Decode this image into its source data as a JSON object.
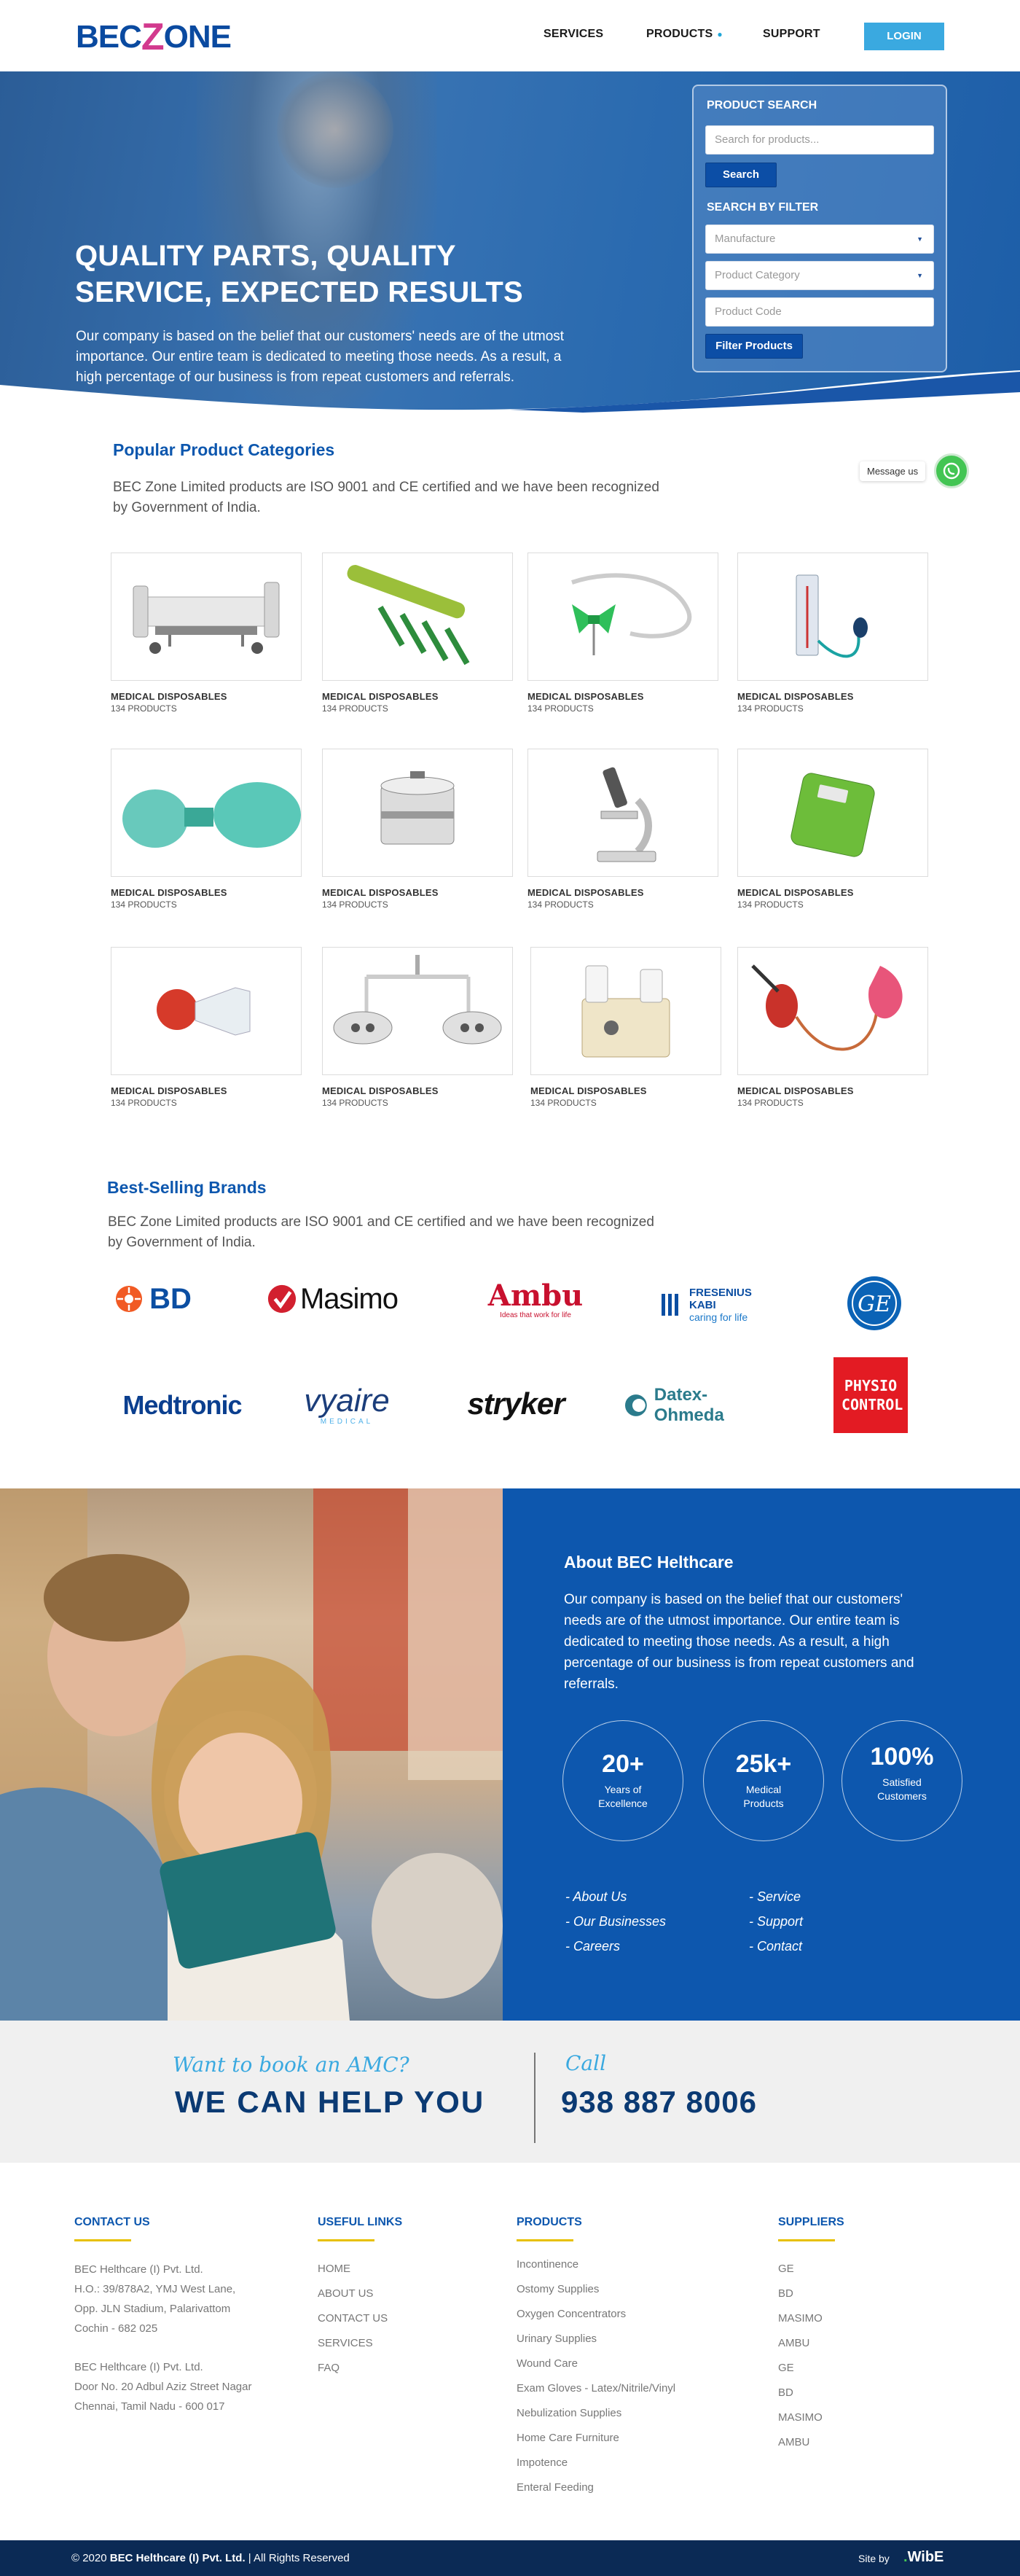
{
  "header": {
    "logo_bec": "BEC",
    "logo_z": "Z",
    "logo_one": "ONE",
    "nav": {
      "services": "SERVICES",
      "products": "PRODUCTS",
      "support": "SUPPORT"
    },
    "login": "LOGIN"
  },
  "hero": {
    "title": "QUALITY PARTS, QUALITY SERVICE, EXPECTED RESULTS",
    "text": "Our company is based on the belief that our customers' needs are of the utmost importance. Our entire team is dedicated to meeting those needs. As a result, a high percentage of our business is from repeat customers and referrals."
  },
  "search_panel": {
    "product_search_heading": "PRODUCT SEARCH",
    "search_placeholder": "Search for products...",
    "search_button": "Search",
    "filter_heading": "SEARCH BY FILTER",
    "manufacture": "Manufacture",
    "category": "Product Category",
    "code_placeholder": "Product Code",
    "filter_button": "Filter Products"
  },
  "popular": {
    "title": "Popular Product Categories",
    "desc": "BEC Zone Limited products are ISO 9001 and CE certified and we have been recognized  by Government of India.",
    "message_label": "Message us",
    "categories": [
      {
        "name": "MEDICAL DISPOSABLES",
        "count": "134 PRODUCTS",
        "icon": "hospital-bed-icon"
      },
      {
        "name": "MEDICAL DISPOSABLES",
        "count": "134 PRODUCTS",
        "icon": "bone-plate-icon"
      },
      {
        "name": "MEDICAL DISPOSABLES",
        "count": "134 PRODUCTS",
        "icon": "butterfly-needle-icon"
      },
      {
        "name": "MEDICAL DISPOSABLES",
        "count": "134 PRODUCTS",
        "icon": "sphygmomanometer-icon"
      },
      {
        "name": "MEDICAL DISPOSABLES",
        "count": "134 PRODUCTS",
        "icon": "resuscitator-bag-icon"
      },
      {
        "name": "MEDICAL DISPOSABLES",
        "count": "134 PRODUCTS",
        "icon": "sterilizer-drum-icon"
      },
      {
        "name": "MEDICAL DISPOSABLES",
        "count": "134 PRODUCTS",
        "icon": "microscope-icon"
      },
      {
        "name": "MEDICAL DISPOSABLES",
        "count": "134 PRODUCTS",
        "icon": "weighing-scale-icon"
      },
      {
        "name": "MEDICAL DISPOSABLES",
        "count": "134 PRODUCTS",
        "icon": "breast-pump-icon"
      },
      {
        "name": "MEDICAL DISPOSABLES",
        "count": "134 PRODUCTS",
        "icon": "surgical-light-icon"
      },
      {
        "name": "MEDICAL DISPOSABLES",
        "count": "134 PRODUCTS",
        "icon": "suction-machine-icon"
      },
      {
        "name": "MEDICAL DISPOSABLES",
        "count": "134 PRODUCTS",
        "icon": "enema-kit-icon"
      }
    ]
  },
  "brands": {
    "title": "Best-Selling Brands",
    "desc": "BEC Zone Limited products are ISO 9001 and CE certified and we have been recognized  by Government of India.",
    "items": [
      {
        "name": "BD",
        "color": "#f15a24"
      },
      {
        "name": "Masimo",
        "color": "#111111",
        "accent": "#d2202f"
      },
      {
        "name": "Ambu",
        "tagline": "Ideas that work for life",
        "color": "#c8102e"
      },
      {
        "name": "FRESENIUS KABI",
        "tagline": "caring for life",
        "color": "#0b4ea2"
      },
      {
        "name": "GE",
        "color": "#0b63b6"
      },
      {
        "name": "Medtronic",
        "color": "#0b3f8f"
      },
      {
        "name": "vyaire",
        "tagline": "MEDICAL",
        "color": "#1b3d7a",
        "accent": "#4db0e8"
      },
      {
        "name": "stryker",
        "color": "#111111"
      },
      {
        "name": "Datex-Ohmeda",
        "color": "#2b7b8c"
      },
      {
        "name": "PHYSIO CONTROL",
        "color": "#e31b23"
      }
    ]
  },
  "about": {
    "title": "About  BEC Helthcare",
    "text": "Our company is based on the belief that our customers' needs are of the utmost importance. Our entire team is dedicated to meeting those needs. As a result, a high percentage of our business is from repeat customers and referrals.",
    "stats": [
      {
        "num": "20+",
        "label": "Years of Excellence"
      },
      {
        "num": "25k+",
        "label": "Medical Products"
      },
      {
        "num": "100%",
        "label": "Satisfied Customers"
      }
    ],
    "links_left": [
      "- About Us",
      "- Our Businesses",
      "- Careers"
    ],
    "links_right": [
      "- Service",
      "- Support",
      "- Contact"
    ]
  },
  "amc": {
    "want": "Want to book an AMC?",
    "help": "WE CAN HELP YOU",
    "call": "Call",
    "phone": "938 887 8006"
  },
  "footer": {
    "contact_heading": "CONTACT US",
    "address1": [
      "BEC Helthcare (I) Pvt. Ltd.",
      "H.O.: 39/878A2, YMJ West Lane,",
      "Opp. JLN Stadium, Palarivattom",
      "Cochin - 682 025"
    ],
    "address2": [
      "BEC Helthcare (I) Pvt. Ltd.",
      "Door No. 20 Adbul Aziz Street Nagar",
      "Chennai, Tamil Nadu - 600 017"
    ],
    "useful_heading": "USEFUL LINKS",
    "useful_links": [
      "HOME",
      "ABOUT US",
      "CONTACT US",
      "SERVICES",
      "FAQ"
    ],
    "products_heading": "PRODUCTS",
    "products": [
      "Incontinence",
      "Ostomy Supplies",
      "Oxygen Concentrators",
      "Urinary Supplies",
      "Wound Care",
      "Exam Gloves - Latex/Nitrile/Vinyl",
      "Nebulization Supplies",
      "Home Care Furniture",
      "Impotence",
      "Enteral Feeding"
    ],
    "suppliers_heading": "SUPPLIERS",
    "suppliers": [
      "GE",
      "BD",
      "MASIMO",
      "AMBU",
      "GE",
      "BD",
      "MASIMO",
      "AMBU"
    ],
    "copyright_prefix": "© 2020",
    "copyright_company": "BEC Helthcare (I) Pvt. Ltd.",
    "copyright_suffix": "| All Rights Reserved",
    "site_by": "Site by",
    "wibe": "WibE"
  }
}
